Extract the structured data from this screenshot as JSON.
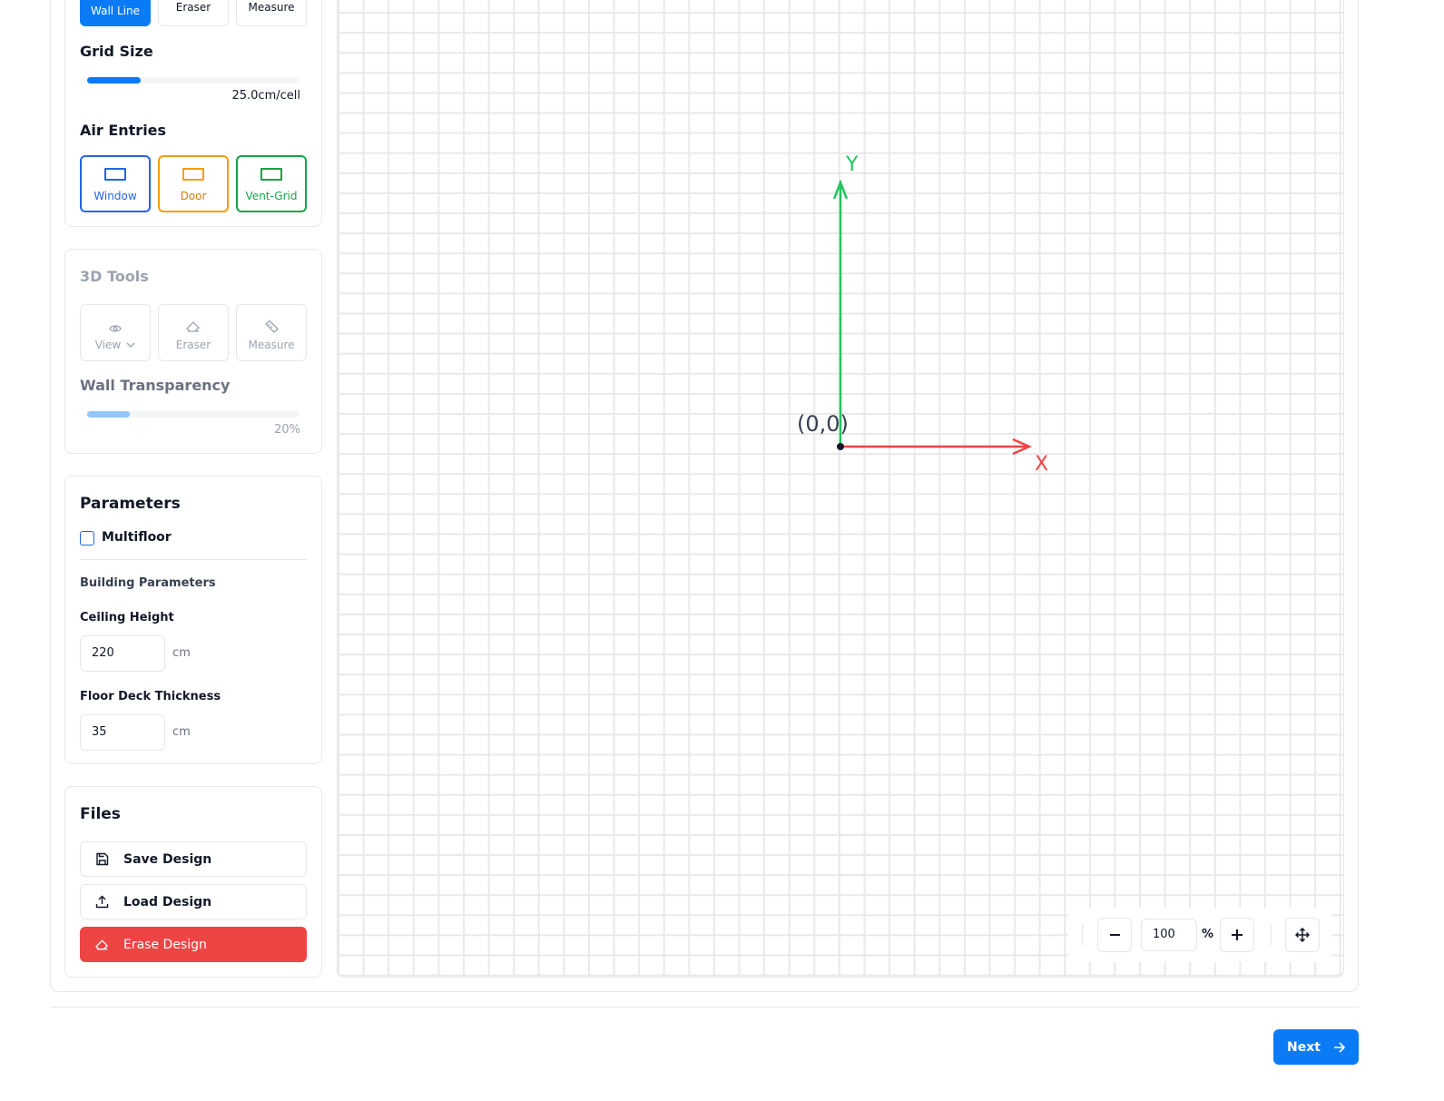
{
  "tools_2d": {
    "wall_line": "Wall Line",
    "eraser": "Eraser",
    "measure": "Measure"
  },
  "grid_size": {
    "heading": "Grid Size",
    "value_label": "25.0cm/cell",
    "fill_fraction": 0.25
  },
  "air_entries": {
    "heading": "Air Entries",
    "window": "Window",
    "door": "Door",
    "vent_grid": "Vent-Grid",
    "colors": {
      "window": "#2563eb",
      "door": "#f59e0b",
      "vent_grid": "#16a34a"
    }
  },
  "tools_3d": {
    "heading": "3D Tools",
    "view": "View",
    "eraser": "Eraser",
    "measure": "Measure",
    "transparency_heading": "Wall Transparency",
    "transparency_value": "20%",
    "transparency_fraction": 0.2
  },
  "parameters": {
    "heading": "Parameters",
    "multifloor_label": "Multifloor",
    "multifloor_checked": false,
    "building_heading": "Building Parameters",
    "ceiling_label": "Ceiling Height",
    "ceiling_value": "220",
    "ceiling_unit": "cm",
    "floor_deck_label": "Floor Deck Thickness",
    "floor_deck_value": "35",
    "floor_deck_unit": "cm"
  },
  "files": {
    "heading": "Files",
    "save": "Save Design",
    "load": "Load Design",
    "erase": "Erase Design"
  },
  "canvas": {
    "origin_label": "(0,0)",
    "x_axis_label": "X",
    "y_axis_label": "Y",
    "x_axis_color": "#ef4444",
    "y_axis_color": "#22c55e"
  },
  "zoom": {
    "value": "100",
    "unit": "%"
  },
  "footer": {
    "next": "Next"
  },
  "colors": {
    "accent": "#0b7bf5",
    "danger": "#ef4444"
  }
}
